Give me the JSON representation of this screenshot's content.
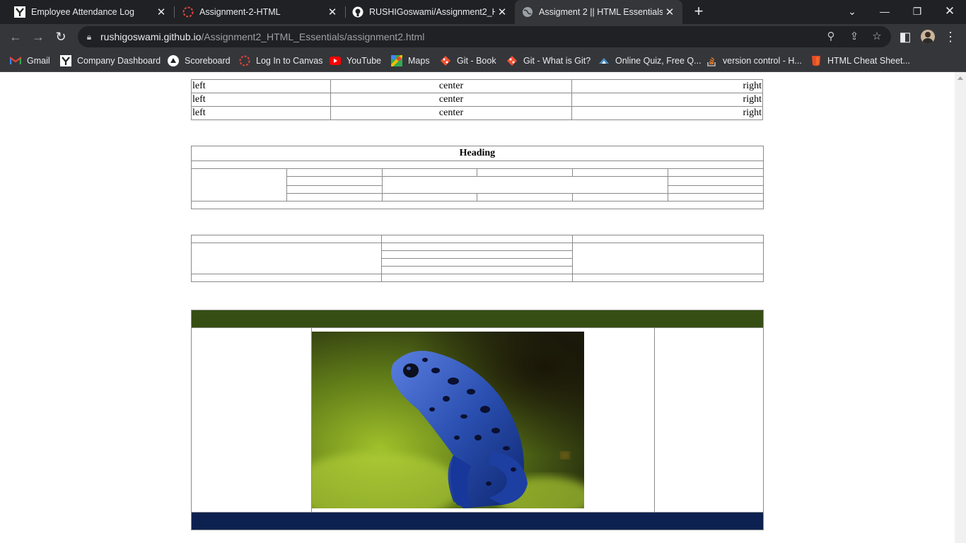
{
  "tabs": [
    {
      "title": "Employee Attendance Log",
      "icon": "y-logo-icon",
      "active": false
    },
    {
      "title": "Assignment-2-HTML",
      "icon": "canvas-icon",
      "active": false
    },
    {
      "title": "RUSHIGoswami/Assignment2_HT",
      "icon": "github-icon",
      "active": false
    },
    {
      "title": "Assigment 2 || HTML Essentials",
      "icon": "globe-icon",
      "active": true
    }
  ],
  "address_bar": {
    "host": "rushigoswami.github.io",
    "path": "/Assignment2_HTML_Essentials/assignment2.html"
  },
  "bookmarks": [
    {
      "label": "Gmail",
      "icon": "gmail-icon"
    },
    {
      "label": "Company Dashboard",
      "icon": "y-logo-icon"
    },
    {
      "label": "Scoreboard",
      "icon": "triangle-icon"
    },
    {
      "label": "Log In to Canvas",
      "icon": "canvas-icon"
    },
    {
      "label": "YouTube",
      "icon": "youtube-icon"
    },
    {
      "label": "Maps",
      "icon": "maps-icon"
    },
    {
      "label": "Git - Book",
      "icon": "git-icon"
    },
    {
      "label": "Git - What is Git?",
      "icon": "git-icon"
    },
    {
      "label": "Online Quiz, Free Q...",
      "icon": "quiz-icon"
    },
    {
      "label": "version control - H...",
      "icon": "stackoverflow-icon"
    },
    {
      "label": "HTML Cheat Sheet...",
      "icon": "html5-icon"
    }
  ],
  "page": {
    "align_table": {
      "rows": [
        [
          "left",
          "center",
          "right"
        ],
        [
          "left",
          "center",
          "right"
        ],
        [
          "left",
          "center",
          "right"
        ]
      ]
    },
    "heading_table": {
      "heading": "Heading"
    },
    "media_table": {
      "header_color": "#364e13",
      "footer_color": "#0d2150",
      "image_description": "blue poison dart frog"
    }
  },
  "colors": {
    "tabbar_bg": "#202124",
    "toolbar_bg": "#35363a",
    "frog_blue": "#2a4fb0"
  }
}
